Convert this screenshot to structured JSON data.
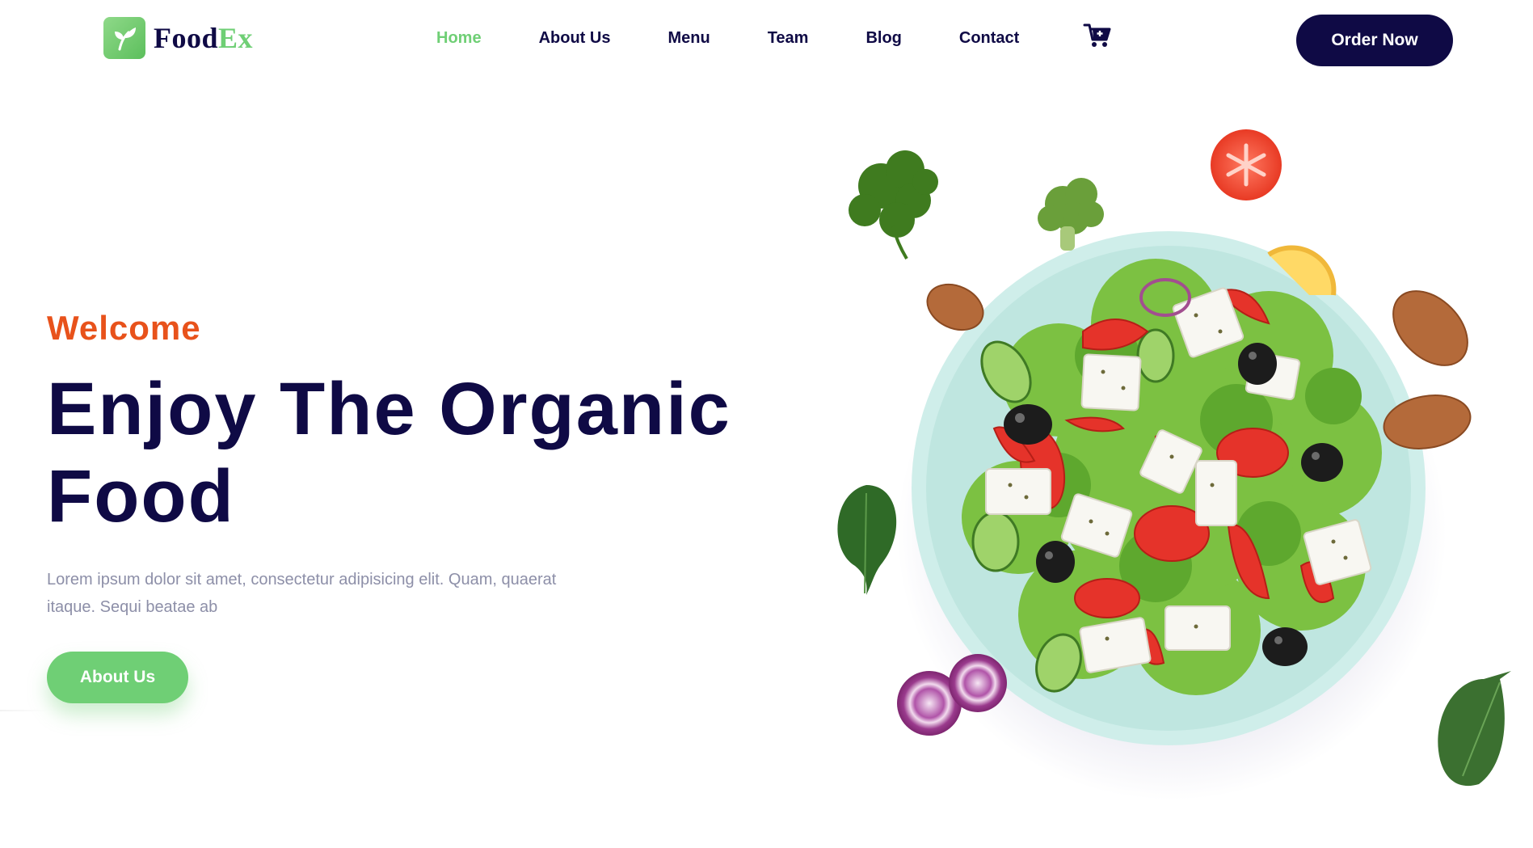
{
  "brand": {
    "name_part1": "Food",
    "name_part2": "Ex",
    "accent_color": "#6fcf75",
    "primary_color": "#0f0a45",
    "highlight_color": "#e8521b"
  },
  "nav": {
    "items": [
      {
        "label": "Home",
        "active": true
      },
      {
        "label": "About Us",
        "active": false
      },
      {
        "label": "Menu",
        "active": false
      },
      {
        "label": "Team",
        "active": false
      },
      {
        "label": "Blog",
        "active": false
      },
      {
        "label": "Contact",
        "active": false
      }
    ],
    "cart_icon": "cart-icon",
    "order_label": "Order Now"
  },
  "hero": {
    "eyebrow": "Welcome",
    "title_line1": "Enjoy The Organic",
    "title_line2": "Food",
    "description": "Lorem ipsum dolor sit amet, consectetur adipisicing elit. Quam, quaerat itaque. Sequi beatae ab",
    "cta_label": "About Us",
    "image": "salad-bowl-image"
  }
}
